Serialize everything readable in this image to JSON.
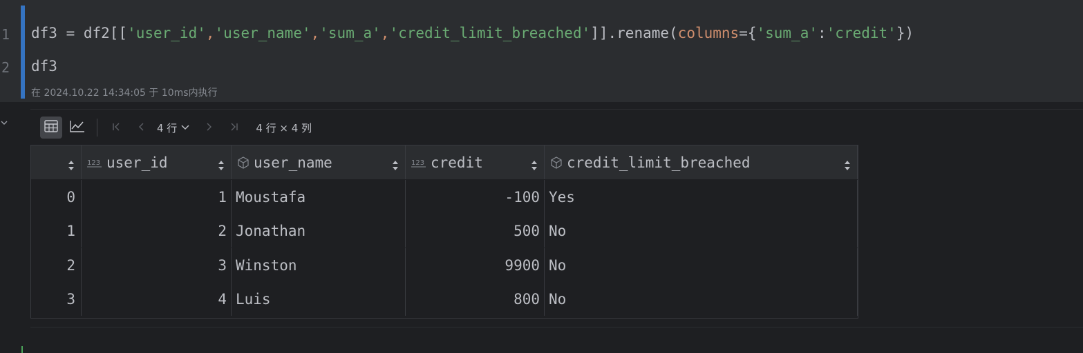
{
  "editor": {
    "line_numbers": [
      "1",
      "2"
    ],
    "line1_tokens": [
      {
        "t": "df3 = df2[[",
        "c": "plain"
      },
      {
        "t": "'user_id'",
        "c": "str"
      },
      {
        "t": ",",
        "c": "kw"
      },
      {
        "t": "'user_name'",
        "c": "str"
      },
      {
        "t": ",",
        "c": "kw"
      },
      {
        "t": "'sum_a'",
        "c": "str"
      },
      {
        "t": ",",
        "c": "kw"
      },
      {
        "t": "'credit_limit_breached'",
        "c": "str"
      },
      {
        "t": "]].rename(",
        "c": "plain"
      },
      {
        "t": "columns",
        "c": "kw"
      },
      {
        "t": "={",
        "c": "plain"
      },
      {
        "t": "'sum_a'",
        "c": "str"
      },
      {
        "t": ":",
        "c": "plain"
      },
      {
        "t": "'credit'",
        "c": "str"
      },
      {
        "t": "})",
        "c": "plain"
      }
    ],
    "line2": "df3",
    "exec_info": "在 2024.10.22 14:34:05 于 10ms内执行"
  },
  "toolbar": {
    "table_view_icon": "table-grid-icon",
    "chart_view_icon": "line-chart-icon",
    "rows_label": "4 行",
    "shape_label": "4 行 × 4 列"
  },
  "table": {
    "columns": [
      {
        "label": "",
        "kind": "index"
      },
      {
        "label": "user_id",
        "kind": "numeric",
        "icon": "numeric-123-icon"
      },
      {
        "label": "user_name",
        "kind": "object",
        "icon": "cube-icon"
      },
      {
        "label": "credit",
        "kind": "numeric",
        "icon": "numeric-123-icon"
      },
      {
        "label": "credit_limit_breached",
        "kind": "object",
        "icon": "cube-icon"
      }
    ],
    "rows": [
      [
        "0",
        "1",
        "Moustafa",
        "-100",
        "Yes"
      ],
      [
        "1",
        "2",
        "Jonathan",
        "500",
        "No"
      ],
      [
        "2",
        "3",
        "Winston",
        "9900",
        "No"
      ],
      [
        "3",
        "4",
        "Luis",
        "800",
        "No"
      ]
    ]
  }
}
